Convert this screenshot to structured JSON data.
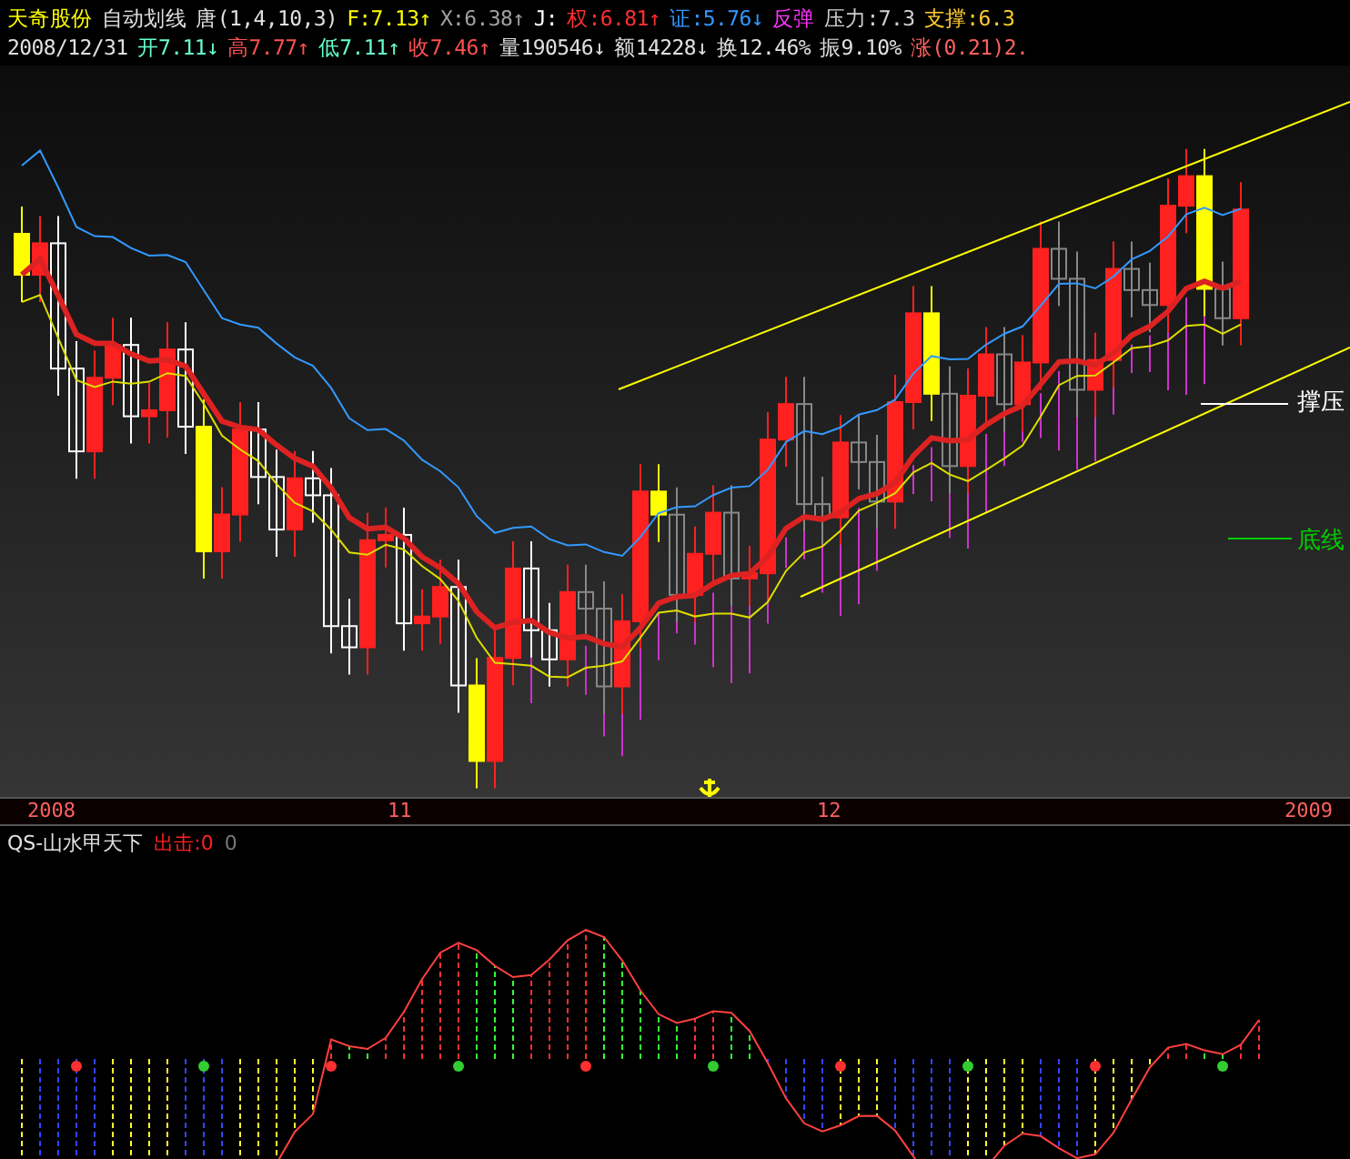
{
  "quote_header": {
    "line_1": [
      {
        "text": "天奇股份",
        "color": "#ffff00"
      },
      {
        "text": "自动划线",
        "color": "#e0e0e0"
      },
      {
        "text": "唐(1,4,10,3)",
        "color": "#e0e0e0"
      },
      {
        "text": "F:7.13↑",
        "color": "#ffff00"
      },
      {
        "text": "X:6.38↑",
        "color": "#a0a0a0"
      },
      {
        "text": "J:",
        "color": "#ffffff"
      },
      {
        "text": "权:6.81↑",
        "color": "#ff3030"
      },
      {
        "text": "证:5.76↓",
        "color": "#3399ff"
      },
      {
        "text": "反弹",
        "color": "#ff33ff"
      },
      {
        "text": "压力:7.3",
        "color": "#d0d0d0"
      },
      {
        "text": "支撑:6.3",
        "color": "#ffcc33"
      }
    ],
    "line_2": [
      {
        "text": "2008/12/31",
        "color": "#e0e0e0"
      },
      {
        "text": "开7.11↓",
        "color": "#66ffcc"
      },
      {
        "text": "高7.77↑",
        "color": "#ff5050"
      },
      {
        "text": "低7.11↑",
        "color": "#66ffcc"
      },
      {
        "text": "收7.46↑",
        "color": "#ff5050"
      },
      {
        "text": "量190546↓",
        "color": "#e0e0e0"
      },
      {
        "text": "额14228↓",
        "color": "#e0e0e0"
      },
      {
        "text": "换12.46%",
        "color": "#e0e0e0"
      },
      {
        "text": "振9.10%",
        "color": "#e0e0e0"
      },
      {
        "text": "涨(0.21)2.",
        "color": "#ff6060"
      }
    ]
  },
  "main_chart": {
    "legend": [
      {
        "text": "撑压",
        "color": "#ffffff"
      },
      {
        "text": "底线",
        "color": "#00cc00"
      }
    ]
  },
  "date_axis": {
    "labels": [
      "2008",
      "11",
      "12",
      "2009"
    ]
  },
  "indicator": {
    "name": "QS-山水甲天下",
    "signal": "出击:0",
    "value": "0"
  }
}
